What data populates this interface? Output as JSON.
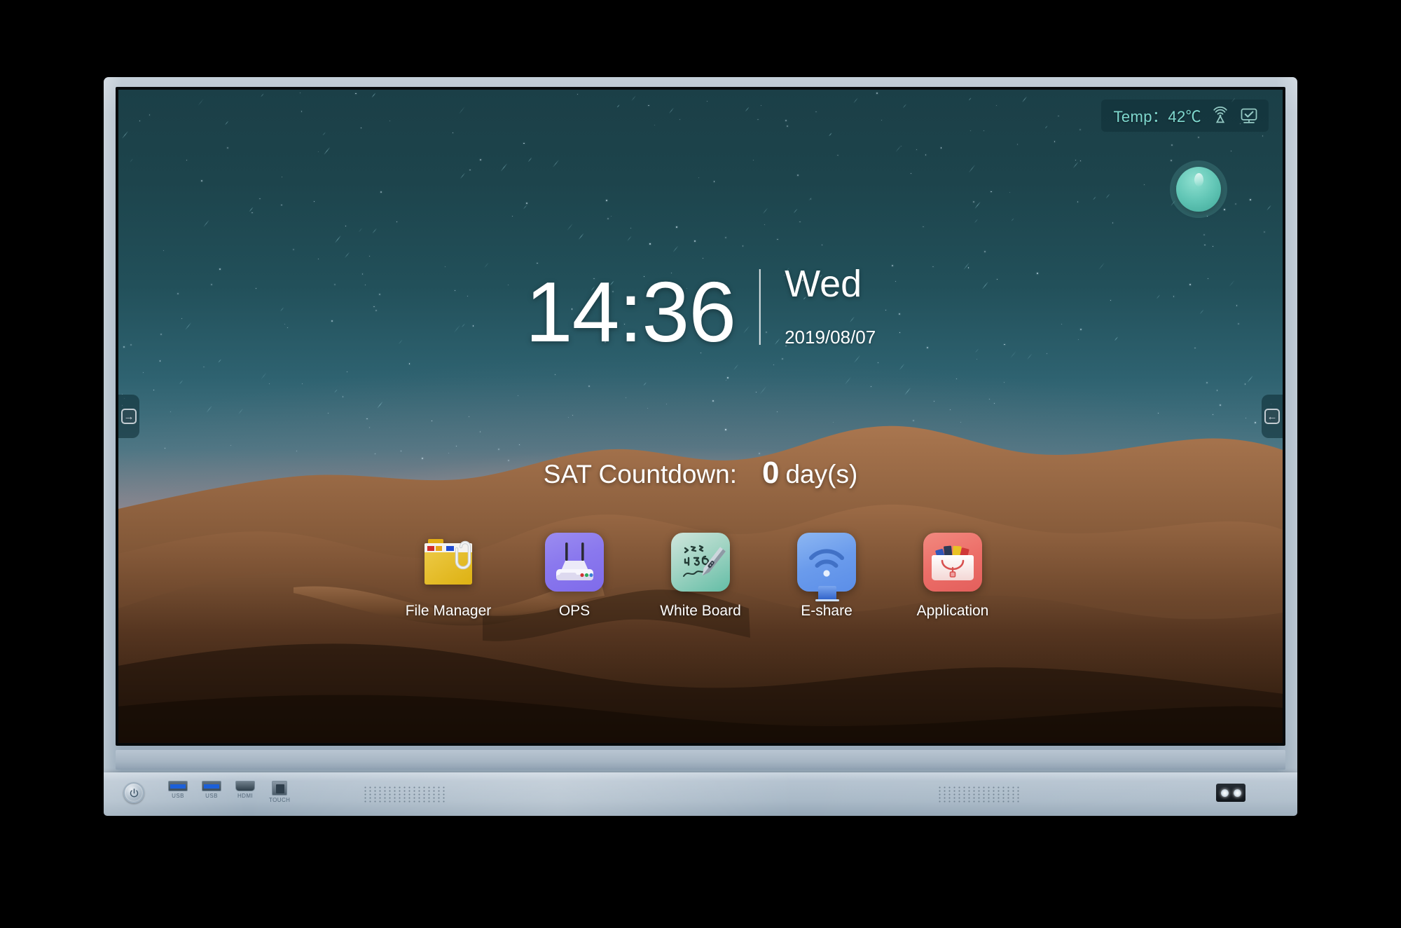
{
  "device": {
    "name": "interactive-flat-panel-display"
  },
  "screen": {
    "statusbar": {
      "temp_label": "Temp：",
      "temp_value": "42℃",
      "icons": [
        {
          "name": "wireless-broadcast-icon"
        },
        {
          "name": "monitor-check-icon"
        }
      ]
    },
    "assistant_button": {
      "name": "floating-assistant-button"
    },
    "clock": {
      "time": "14:36",
      "weekday": "Wed",
      "date": "2019/08/07"
    },
    "countdown": {
      "label": "SAT Countdown:",
      "value": "0",
      "unit": "day(s)"
    },
    "side_handles": {
      "left_glyph": "→",
      "right_glyph": "←"
    },
    "dock": {
      "apps": [
        {
          "label": "File Manager",
          "icon": "file-manager-icon",
          "color": "#edc21f"
        },
        {
          "label": "OPS",
          "icon": "router-icon",
          "color": "#8a78ee"
        },
        {
          "label": "White Board",
          "icon": "whiteboard-icon",
          "color": "#63bda6"
        },
        {
          "label": "E-share",
          "icon": "wifi-cast-icon",
          "color": "#6a9bec"
        },
        {
          "label": "Application",
          "icon": "app-store-icon",
          "color": "#ec6e68"
        }
      ]
    }
  },
  "base": {
    "power_button": {
      "name": "power-button"
    },
    "ports": [
      {
        "label": "USB",
        "type": "usb"
      },
      {
        "label": "USB",
        "type": "usb"
      },
      {
        "label": "HDMI",
        "type": "hdmi"
      },
      {
        "label": "TOUCH",
        "type": "touch"
      }
    ],
    "speakers": [
      {
        "name": "speaker-grille-left"
      },
      {
        "name": "speaker-grille-right"
      }
    ],
    "indicator": {
      "name": "ir-receiver-indicator"
    }
  },
  "colors": {
    "bezel": "#a9b8c6",
    "accent_teal": "#62c6b6",
    "status_text": "#7fd9cf",
    "screen_dark": "#1b3f47"
  }
}
